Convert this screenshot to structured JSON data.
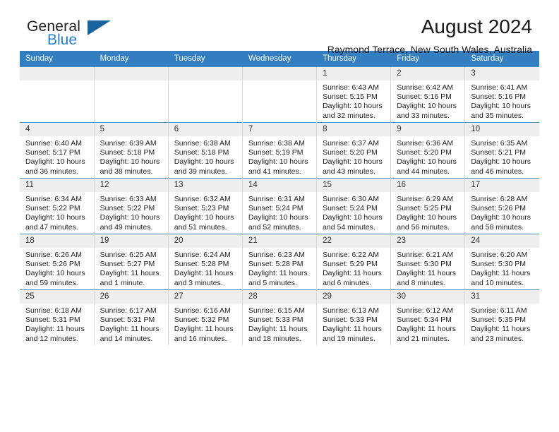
{
  "brand": {
    "name_top": "General",
    "name_bottom": "Blue",
    "accent_color": "#2a7fc9",
    "triangle_color": "#19639f"
  },
  "header": {
    "title": "August 2024",
    "subtitle": "Raymond Terrace, New South Wales, Australia"
  },
  "theme": {
    "header_bg": "#337ec1",
    "daynum_bg": "#eeeeee",
    "row_border": "#4a8fc9",
    "cell_border": "#d9d9d9"
  },
  "weekdays": [
    "Sunday",
    "Monday",
    "Tuesday",
    "Wednesday",
    "Thursday",
    "Friday",
    "Saturday"
  ],
  "weeks": [
    [
      {
        "day": "",
        "sunrise": "",
        "sunset": "",
        "daylight1": "",
        "daylight2": ""
      },
      {
        "day": "",
        "sunrise": "",
        "sunset": "",
        "daylight1": "",
        "daylight2": ""
      },
      {
        "day": "",
        "sunrise": "",
        "sunset": "",
        "daylight1": "",
        "daylight2": ""
      },
      {
        "day": "",
        "sunrise": "",
        "sunset": "",
        "daylight1": "",
        "daylight2": ""
      },
      {
        "day": "1",
        "sunrise": "Sunrise: 6:43 AM",
        "sunset": "Sunset: 5:15 PM",
        "daylight1": "Daylight: 10 hours",
        "daylight2": "and 32 minutes."
      },
      {
        "day": "2",
        "sunrise": "Sunrise: 6:42 AM",
        "sunset": "Sunset: 5:16 PM",
        "daylight1": "Daylight: 10 hours",
        "daylight2": "and 33 minutes."
      },
      {
        "day": "3",
        "sunrise": "Sunrise: 6:41 AM",
        "sunset": "Sunset: 5:16 PM",
        "daylight1": "Daylight: 10 hours",
        "daylight2": "and 35 minutes."
      }
    ],
    [
      {
        "day": "4",
        "sunrise": "Sunrise: 6:40 AM",
        "sunset": "Sunset: 5:17 PM",
        "daylight1": "Daylight: 10 hours",
        "daylight2": "and 36 minutes."
      },
      {
        "day": "5",
        "sunrise": "Sunrise: 6:39 AM",
        "sunset": "Sunset: 5:18 PM",
        "daylight1": "Daylight: 10 hours",
        "daylight2": "and 38 minutes."
      },
      {
        "day": "6",
        "sunrise": "Sunrise: 6:38 AM",
        "sunset": "Sunset: 5:18 PM",
        "daylight1": "Daylight: 10 hours",
        "daylight2": "and 39 minutes."
      },
      {
        "day": "7",
        "sunrise": "Sunrise: 6:38 AM",
        "sunset": "Sunset: 5:19 PM",
        "daylight1": "Daylight: 10 hours",
        "daylight2": "and 41 minutes."
      },
      {
        "day": "8",
        "sunrise": "Sunrise: 6:37 AM",
        "sunset": "Sunset: 5:20 PM",
        "daylight1": "Daylight: 10 hours",
        "daylight2": "and 43 minutes."
      },
      {
        "day": "9",
        "sunrise": "Sunrise: 6:36 AM",
        "sunset": "Sunset: 5:20 PM",
        "daylight1": "Daylight: 10 hours",
        "daylight2": "and 44 minutes."
      },
      {
        "day": "10",
        "sunrise": "Sunrise: 6:35 AM",
        "sunset": "Sunset: 5:21 PM",
        "daylight1": "Daylight: 10 hours",
        "daylight2": "and 46 minutes."
      }
    ],
    [
      {
        "day": "11",
        "sunrise": "Sunrise: 6:34 AM",
        "sunset": "Sunset: 5:22 PM",
        "daylight1": "Daylight: 10 hours",
        "daylight2": "and 47 minutes."
      },
      {
        "day": "12",
        "sunrise": "Sunrise: 6:33 AM",
        "sunset": "Sunset: 5:22 PM",
        "daylight1": "Daylight: 10 hours",
        "daylight2": "and 49 minutes."
      },
      {
        "day": "13",
        "sunrise": "Sunrise: 6:32 AM",
        "sunset": "Sunset: 5:23 PM",
        "daylight1": "Daylight: 10 hours",
        "daylight2": "and 51 minutes."
      },
      {
        "day": "14",
        "sunrise": "Sunrise: 6:31 AM",
        "sunset": "Sunset: 5:24 PM",
        "daylight1": "Daylight: 10 hours",
        "daylight2": "and 52 minutes."
      },
      {
        "day": "15",
        "sunrise": "Sunrise: 6:30 AM",
        "sunset": "Sunset: 5:24 PM",
        "daylight1": "Daylight: 10 hours",
        "daylight2": "and 54 minutes."
      },
      {
        "day": "16",
        "sunrise": "Sunrise: 6:29 AM",
        "sunset": "Sunset: 5:25 PM",
        "daylight1": "Daylight: 10 hours",
        "daylight2": "and 56 minutes."
      },
      {
        "day": "17",
        "sunrise": "Sunrise: 6:28 AM",
        "sunset": "Sunset: 5:26 PM",
        "daylight1": "Daylight: 10 hours",
        "daylight2": "and 58 minutes."
      }
    ],
    [
      {
        "day": "18",
        "sunrise": "Sunrise: 6:26 AM",
        "sunset": "Sunset: 5:26 PM",
        "daylight1": "Daylight: 10 hours",
        "daylight2": "and 59 minutes."
      },
      {
        "day": "19",
        "sunrise": "Sunrise: 6:25 AM",
        "sunset": "Sunset: 5:27 PM",
        "daylight1": "Daylight: 11 hours",
        "daylight2": "and 1 minute."
      },
      {
        "day": "20",
        "sunrise": "Sunrise: 6:24 AM",
        "sunset": "Sunset: 5:28 PM",
        "daylight1": "Daylight: 11 hours",
        "daylight2": "and 3 minutes."
      },
      {
        "day": "21",
        "sunrise": "Sunrise: 6:23 AM",
        "sunset": "Sunset: 5:28 PM",
        "daylight1": "Daylight: 11 hours",
        "daylight2": "and 5 minutes."
      },
      {
        "day": "22",
        "sunrise": "Sunrise: 6:22 AM",
        "sunset": "Sunset: 5:29 PM",
        "daylight1": "Daylight: 11 hours",
        "daylight2": "and 6 minutes."
      },
      {
        "day": "23",
        "sunrise": "Sunrise: 6:21 AM",
        "sunset": "Sunset: 5:30 PM",
        "daylight1": "Daylight: 11 hours",
        "daylight2": "and 8 minutes."
      },
      {
        "day": "24",
        "sunrise": "Sunrise: 6:20 AM",
        "sunset": "Sunset: 5:30 PM",
        "daylight1": "Daylight: 11 hours",
        "daylight2": "and 10 minutes."
      }
    ],
    [
      {
        "day": "25",
        "sunrise": "Sunrise: 6:18 AM",
        "sunset": "Sunset: 5:31 PM",
        "daylight1": "Daylight: 11 hours",
        "daylight2": "and 12 minutes."
      },
      {
        "day": "26",
        "sunrise": "Sunrise: 6:17 AM",
        "sunset": "Sunset: 5:31 PM",
        "daylight1": "Daylight: 11 hours",
        "daylight2": "and 14 minutes."
      },
      {
        "day": "27",
        "sunrise": "Sunrise: 6:16 AM",
        "sunset": "Sunset: 5:32 PM",
        "daylight1": "Daylight: 11 hours",
        "daylight2": "and 16 minutes."
      },
      {
        "day": "28",
        "sunrise": "Sunrise: 6:15 AM",
        "sunset": "Sunset: 5:33 PM",
        "daylight1": "Daylight: 11 hours",
        "daylight2": "and 18 minutes."
      },
      {
        "day": "29",
        "sunrise": "Sunrise: 6:13 AM",
        "sunset": "Sunset: 5:33 PM",
        "daylight1": "Daylight: 11 hours",
        "daylight2": "and 19 minutes."
      },
      {
        "day": "30",
        "sunrise": "Sunrise: 6:12 AM",
        "sunset": "Sunset: 5:34 PM",
        "daylight1": "Daylight: 11 hours",
        "daylight2": "and 21 minutes."
      },
      {
        "day": "31",
        "sunrise": "Sunrise: 6:11 AM",
        "sunset": "Sunset: 5:35 PM",
        "daylight1": "Daylight: 11 hours",
        "daylight2": "and 23 minutes."
      }
    ]
  ]
}
